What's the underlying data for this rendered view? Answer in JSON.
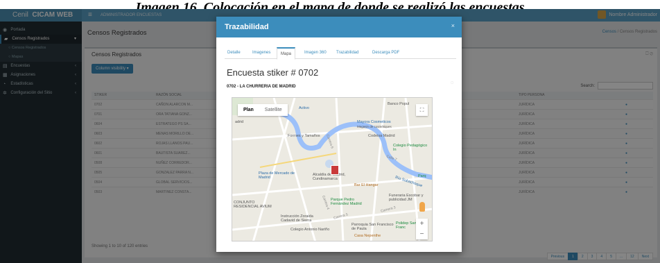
{
  "caption": "Imagen 16. Colocación en el mapa de donde se realizó las encuestas",
  "app": {
    "brand_prefix": "Cenil",
    "brand_name": "CICAM WEB",
    "menu_icon": "bars-icon",
    "top_nav": "ADMINISTRADOR ENCUESTAS",
    "user_name": "Nombre Administrador"
  },
  "sidebar": {
    "items": [
      {
        "label": "Portada",
        "icon": "dashboard-icon"
      },
      {
        "label": "Censos Registrados",
        "icon": "folder-icon"
      },
      {
        "label": "Censos Registrados",
        "sub": true
      },
      {
        "label": "Mapas",
        "sub": true
      },
      {
        "label": "Encuestas",
        "icon": "clipboard-icon"
      },
      {
        "label": "Asignaciones",
        "icon": "grid-icon"
      },
      {
        "label": "Estadísticas",
        "icon": "chart-icon"
      },
      {
        "label": "Configuración del Sitio",
        "icon": "gear-icon"
      }
    ]
  },
  "page": {
    "title": "Censos Registrados",
    "breadcrumb_home": "Censos",
    "breadcrumb_current": "Censos Registrados",
    "box_title": "Censos Registrados",
    "colvis_label": "Column visibility ▾",
    "search_label": "Search:",
    "table": {
      "headers": [
        "STIKER",
        "RAZÓN SOCIAL",
        "TIPO PERSONA",
        ""
      ],
      "rows": [
        [
          "0702",
          "CAÑON ALARCON M...",
          "JURÍDICA",
          "●"
        ],
        [
          "0701",
          "ORA TATIANA GONZ...",
          "JURÍDICA",
          "●"
        ],
        [
          "0604",
          "ESTRATEGO PS SA...",
          "JURÍDICA",
          "●"
        ],
        [
          "0603",
          "MENAS MORILLO DE...",
          "JURÍDICA",
          "●"
        ],
        [
          "0602",
          "ROJAS LLANOS PAU...",
          "JURÍDICA",
          "●"
        ],
        [
          "0601",
          "BAUTISTA SUAREZ...",
          "JURÍDICA",
          "●"
        ],
        [
          "0508",
          "NUÑEZ CORREDOR...",
          "JURÍDICA",
          "●"
        ],
        [
          "0505",
          "GONZALEZ PARRA N...",
          "JURÍDICA",
          "●"
        ],
        [
          "0504",
          "GLOBAL SERVICIOS...",
          "JURÍDICA",
          "●"
        ],
        [
          "0503",
          "MARTINEZ CONSTA...",
          "JURÍDICA",
          "●"
        ]
      ]
    },
    "info": "Showing 1 to 10 of 120 entries",
    "pager": [
      "Previous",
      "1",
      "2",
      "3",
      "4",
      "5",
      "...",
      "12",
      "Next"
    ]
  },
  "modal": {
    "title": "Trazabilidad",
    "close": "×",
    "tabs": [
      "Detalle",
      "Imagenes",
      "Mapa",
      "Imagen 360",
      "Trazabilidad",
      "Descarga PDF"
    ],
    "active_tab": "Mapa",
    "heading": "Encuesta stiker # 0702",
    "subheading": "0702 - LA CHURRERIA DE MADRID",
    "map": {
      "type_plan": "Plan",
      "type_satellite": "Satellite",
      "zoom_in": "+",
      "zoom_out": "−",
      "labels": {
        "activo": "Activo",
        "madrid": "adrid",
        "banco": "Banco Popul",
        "mayora": "Mayora Cosmeticos",
        "mayora_sub": "Magasin de cosmétiques",
        "formes": "Formes y Tamaños",
        "codeisa": "Codeisa Madrid",
        "colegio_ped": "Colegio Pedagógico In",
        "calle7": "Calle 7",
        "plaza": "Plaza de Mercado de Madrid",
        "alcaldia": "Alcaldía de Madrid, Cundinamarca",
        "barel": "Bar El Hangar",
        "parque_short": "Parq",
        "funeraria": "Funeraria Escobar y publicidad JM",
        "conjunto": "CONJUNTO RESIDENCIAL AVIUM",
        "parque_pedro": "Parque Pedro Fernández Madrid",
        "carrera4": "Carrera 4",
        "carrera5": "Carrera 5",
        "carrera6": "Carrera 6",
        "instruccion": "Instrucción Zoraida Cadavid de Sierra",
        "colegio_nariño": "Colegio Antonio Nariño",
        "parroquia": "Parroquia San Francisco de Paula",
        "casa": "Casa Nepenthe",
        "poli": "Polidep San Franc",
        "rio": "Río Subachoque",
        "camera3": "Camera 3"
      }
    }
  }
}
